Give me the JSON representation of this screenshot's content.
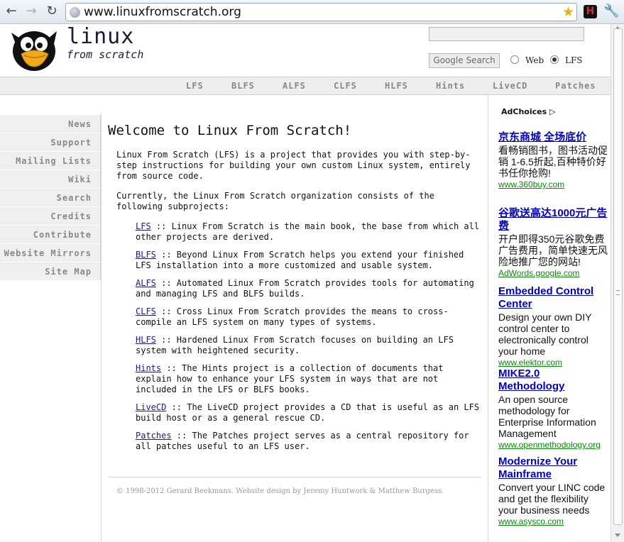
{
  "browser": {
    "url": "www.linuxfromscratch.org",
    "back_icon": "←",
    "forward_icon": "→",
    "reload_icon": "↻",
    "star_icon": "★",
    "ext_label": "H",
    "wrench_icon": "🔧"
  },
  "header": {
    "logo_title": "linux",
    "logo_subtitle": "from scratch",
    "search_button": "Google Search",
    "radio_web": "Web",
    "radio_lfs": "LFS",
    "selected_scope": "LFS"
  },
  "topnav": [
    "LFS",
    "BLFS",
    "ALFS",
    "CLFS",
    "HLFS",
    "Hints",
    "LiveCD",
    "Patches"
  ],
  "sidebar": [
    "News",
    "Support",
    "Mailing Lists",
    "Wiki",
    "Search",
    "Credits",
    "Contribute",
    "Website Mirrors",
    "Site Map"
  ],
  "main": {
    "title": "Welcome to Linux From Scratch!",
    "intro": "Linux From Scratch (LFS) is a project that provides you with step-by-step instructions for building your own custom Linux system, entirely from source code.",
    "currently": "Currently, the Linux From Scratch organization consists of the following subprojects:",
    "projects": [
      {
        "name": "LFS",
        "desc": " :: Linux From Scratch is the main book, the base from which all other projects are derived."
      },
      {
        "name": "BLFS",
        "desc": " :: Beyond Linux From Scratch helps you extend your finished LFS installation into a more customized and usable system."
      },
      {
        "name": "ALFS",
        "desc": " :: Automated Linux From Scratch provides tools for automating and managing LFS and BLFS builds."
      },
      {
        "name": "CLFS",
        "desc": " :: Cross Linux From Scratch provides the means to cross-compile an LFS system on many types of systems."
      },
      {
        "name": "HLFS",
        "desc": " :: Hardened Linux From Scratch focuses on building an LFS system with heightened security."
      },
      {
        "name": "Hints",
        "desc": " :: The Hints project is a collection of documents that explain how to enhance your LFS system in ways that are not included in the LFS or BLFS books."
      },
      {
        "name": "LiveCD",
        "desc": " :: The LiveCD project provides a CD that is useful as an LFS build host or as a general rescue CD."
      },
      {
        "name": "Patches",
        "desc": " :: The Patches project serves as a central repository for all patches useful to an LFS user."
      }
    ],
    "footer": "© 1998-2012 Gerard Beekmans. Website design by Jeremy Huntwork & Matthew Burgess."
  },
  "ads": {
    "adchoices": "AdChoices ▷",
    "items": [
      {
        "title": "京东商城 全场底价",
        "desc": "看畅销图书，图书活动促销 1-6.5折起,百种特价好书任你抢购!",
        "url": "www.360buy.com"
      },
      {
        "title": "谷歌送高达1000元广告费",
        "desc": "开户即得350元谷歌免费广告费用，简单快速无风险地推广您的网站!",
        "url": "AdWords.google.com"
      },
      {
        "title": "Embedded Control Center",
        "desc": "Design your own DIY control center to electronically control your home",
        "url": "www.elektor.com"
      },
      {
        "title": "MIKE2.0 Methodology",
        "desc": "An open source methodology for Enterprise Information Management",
        "url": "www.openmethodology.org"
      },
      {
        "title": "Modernize Your Mainframe",
        "desc": "Convert your LINC code and get the flexibility your business needs",
        "url": "www.asysco.com"
      }
    ]
  }
}
